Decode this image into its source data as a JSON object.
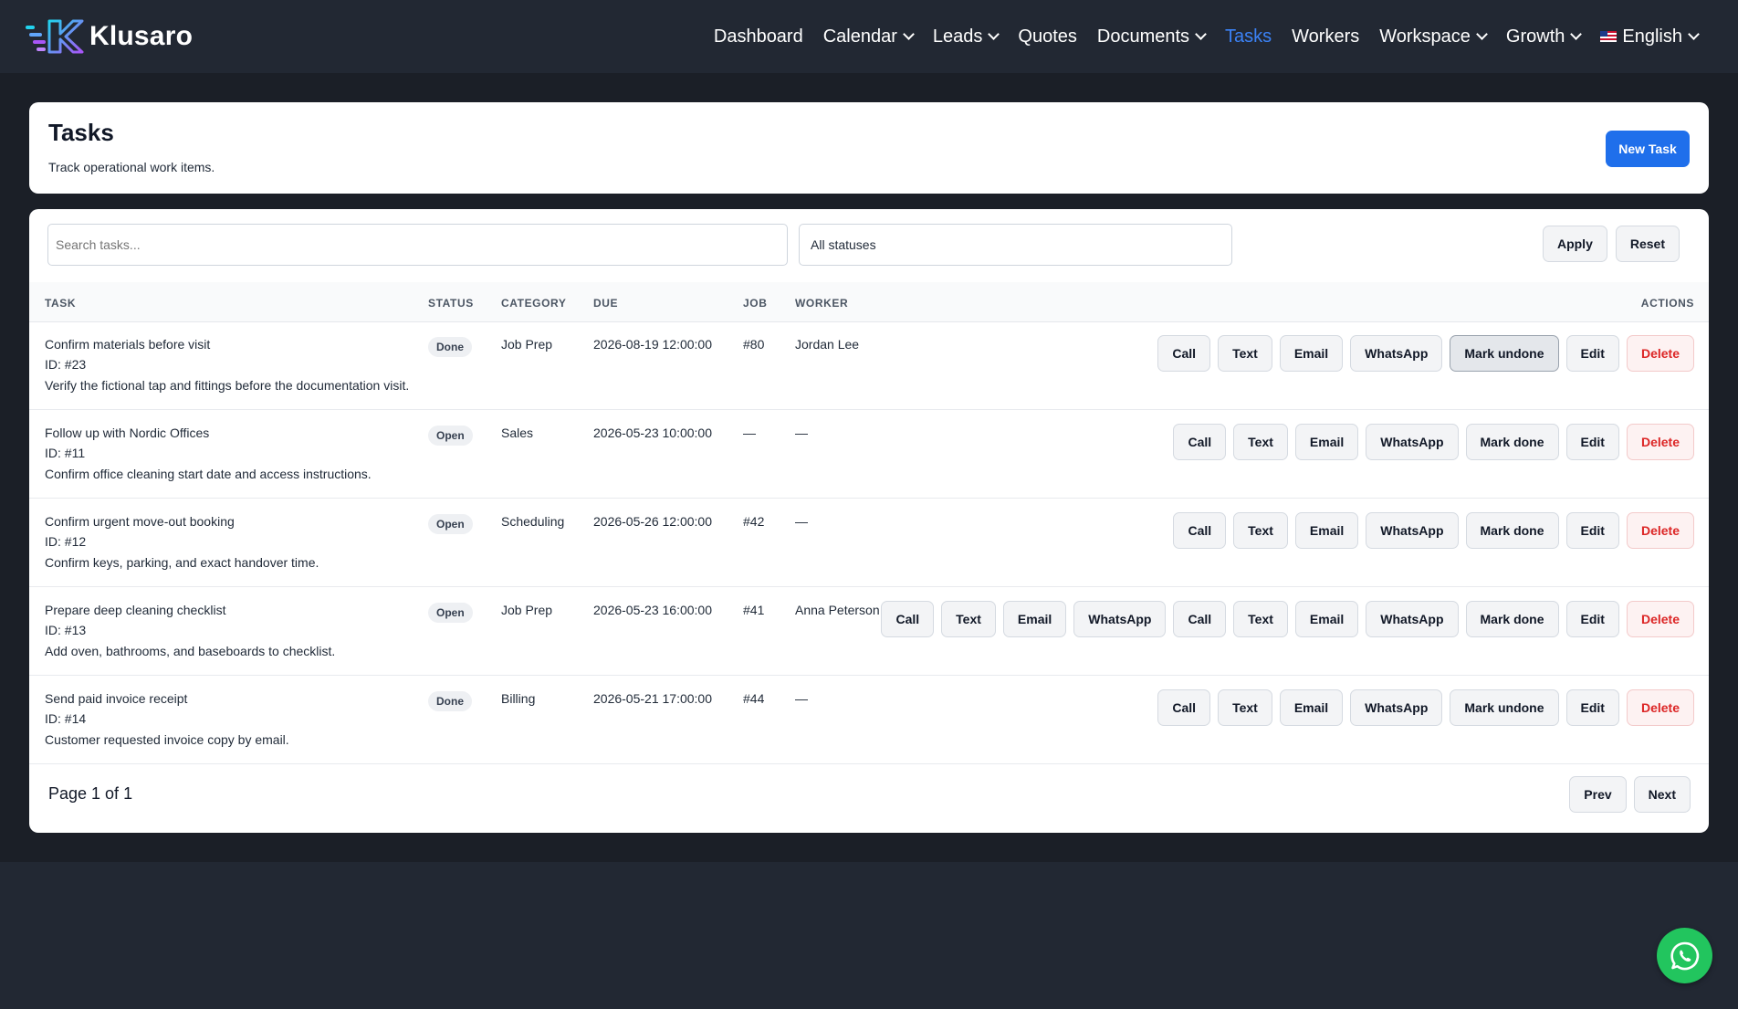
{
  "app": {
    "brand": "Klusaro"
  },
  "nav": {
    "items": [
      {
        "label": "Dashboard",
        "has_menu": false,
        "active": false
      },
      {
        "label": "Calendar",
        "has_menu": true,
        "active": false
      },
      {
        "label": "Leads",
        "has_menu": true,
        "active": false
      },
      {
        "label": "Quotes",
        "has_menu": false,
        "active": false
      },
      {
        "label": "Documents",
        "has_menu": true,
        "active": false
      },
      {
        "label": "Tasks",
        "has_menu": false,
        "active": true
      },
      {
        "label": "Workers",
        "has_menu": false,
        "active": false
      },
      {
        "label": "Workspace",
        "has_menu": true,
        "active": false
      },
      {
        "label": "Growth",
        "has_menu": true,
        "active": false
      }
    ],
    "language": "English",
    "active_color": "#3b82f6"
  },
  "header": {
    "title": "Tasks",
    "subtitle": "Track operational work items.",
    "new_task_label": "New Task"
  },
  "filters": {
    "search_placeholder": "Search tasks...",
    "status_selected": "All statuses",
    "apply_label": "Apply",
    "reset_label": "Reset"
  },
  "table": {
    "headers": {
      "task": "TASK",
      "status": "STATUS",
      "category": "CATEGORY",
      "due": "DUE",
      "job": "JOB",
      "worker": "WORKER",
      "actions": "ACTIONS"
    },
    "rows": [
      {
        "title": "Confirm materials before visit",
        "id": "ID: #23",
        "description": "Verify the fictional tap and fittings before the documentation visit.",
        "status": "Done",
        "category": "Job Prep",
        "due": "2026-08-19 12:00:00",
        "job": "#80",
        "worker": "Jordan Lee",
        "actions": [
          "Call",
          "Text",
          "Email",
          "WhatsApp",
          "Mark undone",
          "Edit",
          "Delete"
        ],
        "pressed_action": "Mark undone"
      },
      {
        "title": "Follow up with Nordic Offices",
        "id": "ID: #11",
        "description": "Confirm office cleaning start date and access instructions.",
        "status": "Open",
        "category": "Sales",
        "due": "2026-05-23 10:00:00",
        "job": "—",
        "worker": "—",
        "actions": [
          "Call",
          "Text",
          "Email",
          "WhatsApp",
          "Mark done",
          "Edit",
          "Delete"
        ]
      },
      {
        "title": "Confirm urgent move-out booking",
        "id": "ID: #12",
        "description": "Confirm keys, parking, and exact handover time.",
        "status": "Open",
        "category": "Scheduling",
        "due": "2026-05-26 12:00:00",
        "job": "#42",
        "worker": "—",
        "actions": [
          "Call",
          "Text",
          "Email",
          "WhatsApp",
          "Mark done",
          "Edit",
          "Delete"
        ]
      },
      {
        "title": "Prepare deep cleaning checklist",
        "id": "ID: #13",
        "description": "Add oven, bathrooms, and baseboards to checklist.",
        "status": "Open",
        "category": "Job Prep",
        "due": "2026-05-23 16:00:00",
        "job": "#41",
        "worker": "Anna Peterson",
        "actions": [
          "Call",
          "Text",
          "Email",
          "WhatsApp",
          "Call",
          "Text",
          "Email",
          "WhatsApp",
          "Mark done",
          "Edit",
          "Delete"
        ]
      },
      {
        "title": "Send paid invoice receipt",
        "id": "ID: #14",
        "description": "Customer requested invoice copy by email.",
        "status": "Done",
        "category": "Billing",
        "due": "2026-05-21 17:00:00",
        "job": "#44",
        "worker": "—",
        "actions": [
          "Call",
          "Text",
          "Email",
          "WhatsApp",
          "Mark undone",
          "Edit",
          "Delete"
        ]
      }
    ]
  },
  "pagination": {
    "text": "Page 1 of 1",
    "prev_label": "Prev",
    "next_label": "Next"
  },
  "colors": {
    "primary": "#1f6feb",
    "delete": "#dc2626",
    "whatsapp": "#22c55e",
    "background": "#222833"
  },
  "whatsapp_fab": {
    "icon": "whatsapp-icon"
  }
}
